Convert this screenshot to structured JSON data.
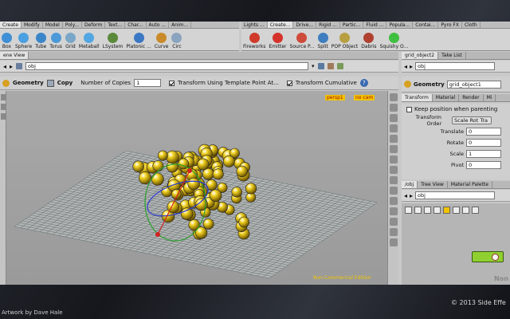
{
  "shelf_tabs_left": [
    "Create",
    "Modify",
    "Model",
    "Poly...",
    "Deform",
    "Text...",
    "Char...",
    "Auto ...",
    "Anim..."
  ],
  "shelf_tabs_right": [
    "Lights ...",
    "Create...",
    "Drive...",
    "Rigid ...",
    "Partic...",
    "Fluid ...",
    "Popula...",
    "Contai...",
    "Pyro FX",
    "Cloth"
  ],
  "tools_left": [
    {
      "label": "Box",
      "color": "#3f8fd6"
    },
    {
      "label": "Sphere",
      "color": "#4aa0e0"
    },
    {
      "label": "Tube",
      "color": "#3b86c8"
    },
    {
      "label": "Torus",
      "color": "#4c99d9"
    },
    {
      "label": "Grid",
      "color": "#7aa7c8"
    },
    {
      "label": "Metaball",
      "color": "#52a7e2"
    },
    {
      "label": "LSystem",
      "color": "#5a8a3a"
    },
    {
      "label": "Platonic ...",
      "color": "#3a78c4"
    },
    {
      "label": "Curve",
      "color": "#c98a2a"
    },
    {
      "label": "Circ",
      "color": "#8aa4c0"
    }
  ],
  "tools_right": [
    {
      "label": "Fireworks",
      "color": "#d03a2a"
    },
    {
      "label": "Emitter",
      "color": "#d5332a"
    },
    {
      "label": "Source P...",
      "color": "#cf4a3a"
    },
    {
      "label": "Split",
      "color": "#3e7ec0"
    },
    {
      "label": "POP Object",
      "color": "#b8a040"
    },
    {
      "label": "Dabris",
      "color": "#b04030"
    },
    {
      "label": "Squishy O...",
      "color": "#3fbf3f"
    }
  ],
  "left_pane": {
    "tabs": [
      "ene View",
      "obj"
    ],
    "path": "obj",
    "operation": "Geometry",
    "mode": "Copy",
    "num_copies_label": "Number of Copies",
    "num_copies_value": "1",
    "transform_template_label": "Transform Using Template Point At...",
    "transform_cumulative_label": "Transform Cumulative",
    "persp_label": "persp1",
    "cam_label": "no cam",
    "watermark": "Non-Commercial Edition"
  },
  "right_pane": {
    "tabs": [
      "grid_object2",
      "Take List"
    ],
    "path": "obj",
    "operation": "Geometry",
    "object_name": "grid_object1",
    "param_tabs": [
      "Transform",
      "Material",
      "Render",
      "Mi"
    ],
    "keep_position_label": "Keep position when parenting",
    "transform_order_label": "Transform Order",
    "transform_order_value": "Scale Rot Tra",
    "rows": [
      {
        "label": "Translate",
        "value": "0"
      },
      {
        "label": "Rotate",
        "value": "0"
      },
      {
        "label": "Scale",
        "value": "1"
      },
      {
        "label": "Pivot",
        "value": "0"
      }
    ],
    "net_tabs": [
      "/obj",
      "Tree View",
      "Material Palette"
    ],
    "net_path": "obj",
    "net_watermark": "Non"
  },
  "footer": {
    "artwork_credit": "Artwork by Dave Hale",
    "copyright": "© 2013 Side Effe"
  },
  "colors": {
    "accent": "#f2c400",
    "viewport_bg": "#a3a3a3",
    "grid_line": "#5b6f6f",
    "spheres": "#f0d020"
  }
}
